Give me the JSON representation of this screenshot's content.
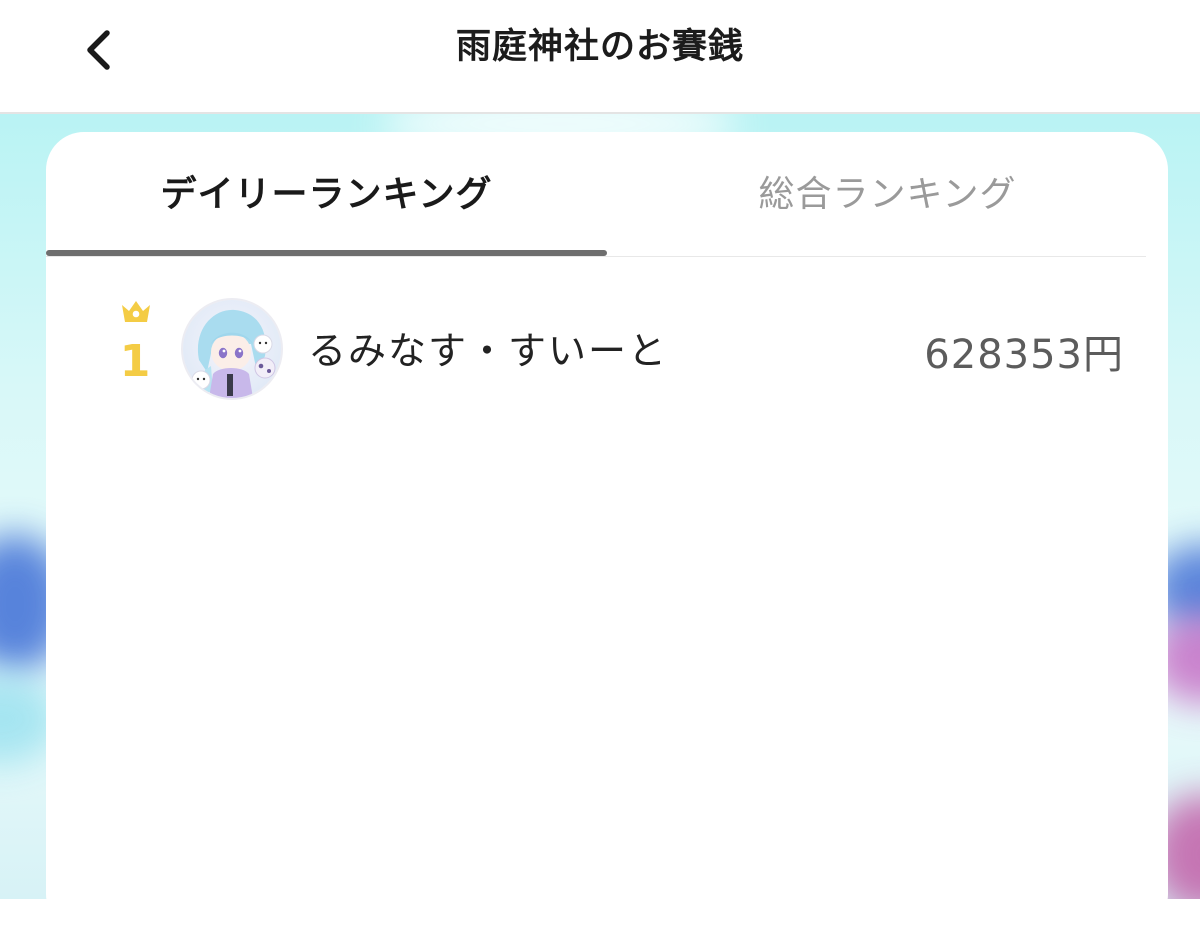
{
  "header": {
    "title": "雨庭神社のお賽銭",
    "back_icon": "chevron-left-icon"
  },
  "tabs": [
    {
      "label": "デイリーランキング",
      "active": true
    },
    {
      "label": "総合ランキング",
      "active": false
    }
  ],
  "ranking": [
    {
      "rank": "1",
      "rank_icon": "crown-icon",
      "name": "るみなす・すいーと",
      "amount": "628353円"
    }
  ],
  "colors": {
    "rank_gold": "#f4cc45",
    "tab_indicator": "#6e6e6e",
    "inactive_tab": "#9a9a9a",
    "background_tint": "#b9f3f4"
  }
}
